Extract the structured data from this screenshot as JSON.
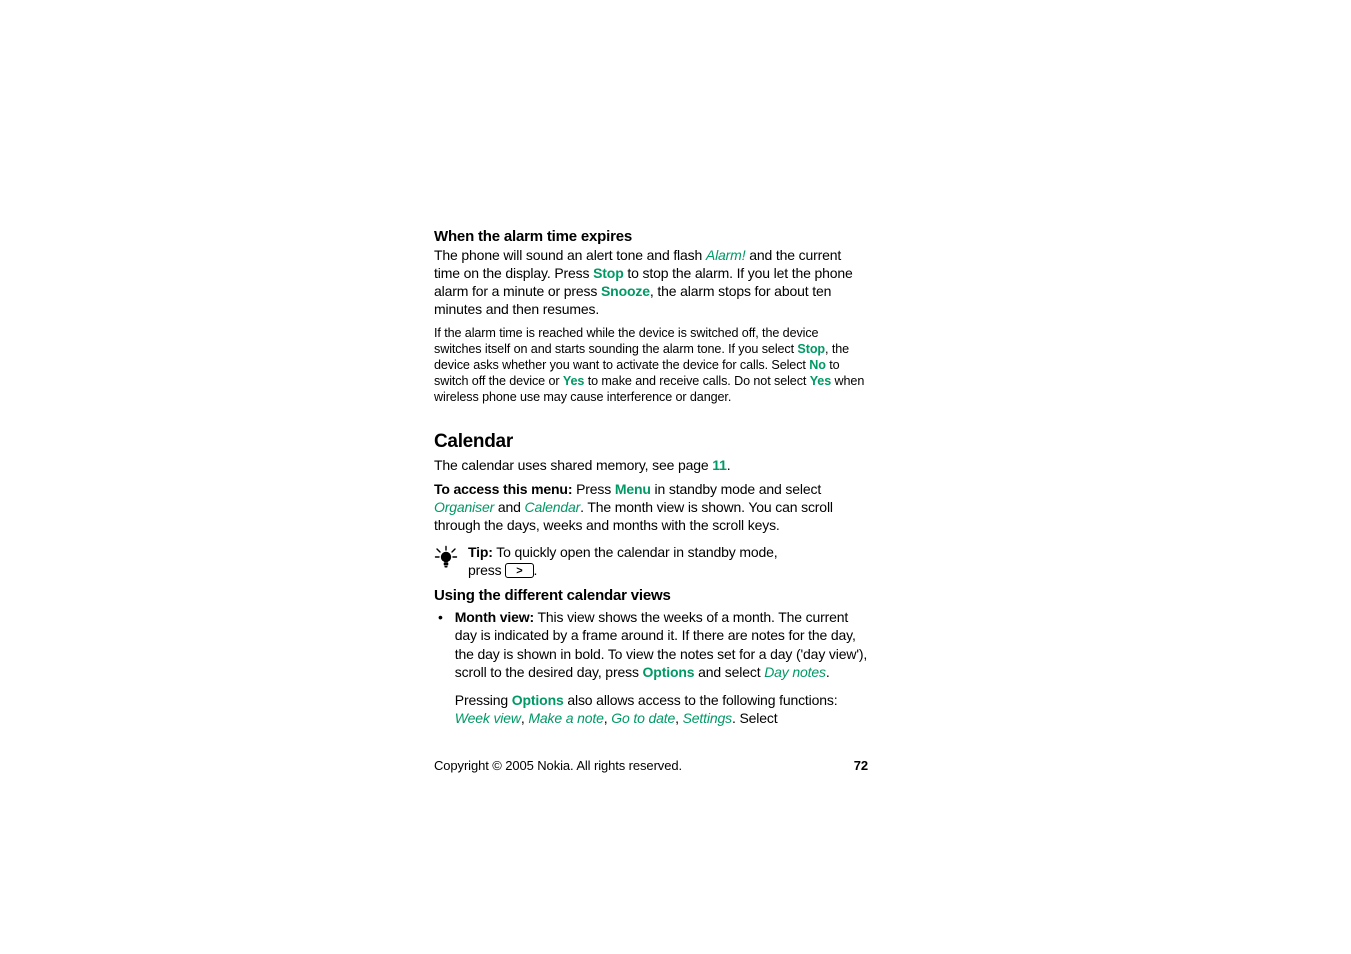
{
  "alarm_expires": {
    "heading": "When the alarm time expires",
    "p1_pre": "The phone will sound an alert tone and flash ",
    "p1_alarm": "Alarm!",
    "p1_mid1": " and the current time on the display. Press ",
    "p1_stop": "Stop",
    "p1_mid2": " to stop the alarm. If you let the phone alarm for a minute or press ",
    "p1_snooze": "Snooze",
    "p1_after": ", the alarm stops for about ten minutes and then resumes.",
    "p2_pre": "If the alarm time is reached while the device is switched off, the device switches itself on and starts sounding the alarm tone. If you select ",
    "p2_stop": "Stop",
    "p2_mid1": ", the device asks whether you want to activate the device for calls. Select ",
    "p2_no": "No",
    "p2_mid2": " to switch off the device or ",
    "p2_yes": "Yes",
    "p2_mid3": " to make and receive calls. Do not select ",
    "p2_yes2": "Yes",
    "p2_after": " when wireless phone use may cause interference or danger."
  },
  "calendar": {
    "heading": "Calendar",
    "p1_pre": "The calendar uses shared memory, see page ",
    "p1_page": "11",
    "p1_after": ".",
    "p2_bold": "To access this menu:",
    "p2_mid1": " Press ",
    "p2_menu": "Menu",
    "p2_mid2": " in standby mode and select ",
    "p2_organiser": "Organiser",
    "p2_mid3": " and ",
    "p2_calendar": "Calendar",
    "p2_after": ". The month view is shown. You can scroll through the days, weeks and months with the scroll keys.",
    "tip_bold": "Tip:",
    "tip_line1": " To quickly open the calendar in standby mode,",
    "tip_line2_pre": "press ",
    "tip_key_glyph": ">",
    "tip_line2_after": "."
  },
  "views": {
    "heading": "Using the different calendar views",
    "bullet_bold": "Month view:",
    "bullet_text1": " This view shows the weeks of a month. The current day is indicated by a frame around it. If there are notes for the day, the day is shown in bold. To view the notes set for a day ('day view'), scroll to the desired day, press ",
    "bullet_options": "Options",
    "bullet_text2": " and select ",
    "bullet_daynotes": "Day notes",
    "bullet_text3": ".",
    "sub_pre": "Pressing ",
    "sub_options": "Options",
    "sub_mid": " also allows access to the following functions: ",
    "sub_weekview": "Week view",
    "sub_c1": ", ",
    "sub_makenote": "Make a note",
    "sub_c2": ", ",
    "sub_gotodate": "Go to date",
    "sub_c3": ", ",
    "sub_settings": "Settings",
    "sub_after": ". Select"
  },
  "footer": {
    "copyright": "Copyright © 2005 Nokia. All rights reserved.",
    "page": "72"
  }
}
